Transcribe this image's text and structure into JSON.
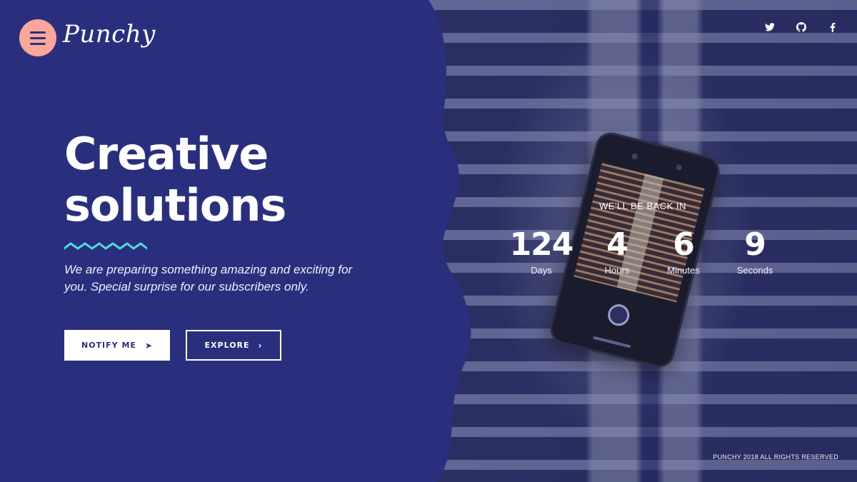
{
  "brand": {
    "logo_text": "Punchy"
  },
  "colors": {
    "primary": "#2a2f7d",
    "accent_pink": "#f9a79a",
    "zigzag_teal": "#4de0e0",
    "text": "#ffffff"
  },
  "social": [
    {
      "icon": "twitter-icon",
      "glyph": "🐦"
    },
    {
      "icon": "github-icon",
      "glyph": "◉"
    },
    {
      "icon": "facebook-icon",
      "glyph": "f"
    }
  ],
  "hero": {
    "title_line1": "Creative",
    "title_line2": "solutions",
    "description": "We are preparing something amazing and exciting for you. Special surprise for our subscribers only.",
    "notify_label": "NOTIFY ME",
    "explore_label": "EXPLORE"
  },
  "countdown": {
    "heading": "WE'LL BE BACK IN",
    "units": [
      {
        "value": "124",
        "label": "Days"
      },
      {
        "value": "4",
        "label": "Hours"
      },
      {
        "value": "6",
        "label": "Minutes"
      },
      {
        "value": "9",
        "label": "Seconds"
      }
    ]
  },
  "footer": {
    "copyright": "PUNCHY 2018 ALL RIGHTS RESERVED"
  }
}
